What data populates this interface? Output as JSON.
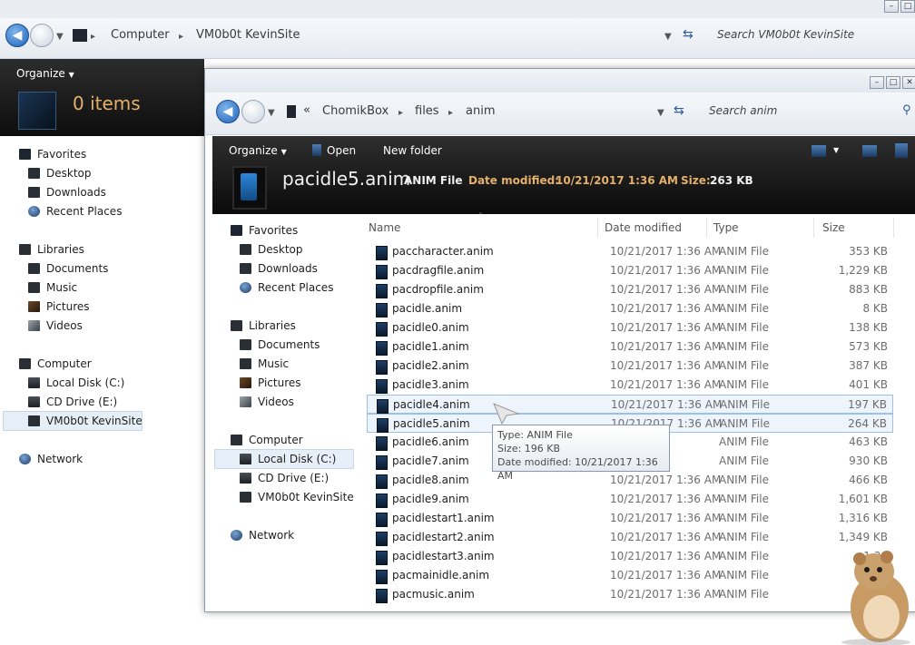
{
  "bg_window": {
    "breadcrumb": [
      "Computer",
      "VM0b0t KevinSite"
    ],
    "search_placeholder": "Search VM0b0t KevinSite",
    "organize_label": "Organize",
    "items_count": "0 items",
    "nav": {
      "favorites": {
        "label": "Favorites",
        "items": [
          "Desktop",
          "Downloads",
          "Recent Places"
        ]
      },
      "libraries": {
        "label": "Libraries",
        "items": [
          "Documents",
          "Music",
          "Pictures",
          "Videos"
        ]
      },
      "computer": {
        "label": "Computer",
        "items": [
          "Local Disk (C:)",
          "CD Drive (E:)",
          "VM0b0t KevinSite"
        ]
      },
      "network": "Network"
    }
  },
  "fg_window": {
    "breadcrumb_prefix": "«",
    "breadcrumb": [
      "ChomikBox",
      "files",
      "anim"
    ],
    "search_placeholder": "Search anim",
    "toolbar": {
      "organize": "Organize",
      "open": "Open",
      "new_folder": "New folder"
    },
    "details": {
      "filename": "pacidle5.anim",
      "type": "ANIM File",
      "date_label": "Date modified:",
      "date_value": "10/21/2017 1:36 AM",
      "size_label": "Size:",
      "size_value": "263 KB"
    },
    "nav": {
      "favorites": {
        "label": "Favorites",
        "items": [
          "Desktop",
          "Downloads",
          "Recent Places"
        ]
      },
      "libraries": {
        "label": "Libraries",
        "items": [
          "Documents",
          "Music",
          "Pictures",
          "Videos"
        ]
      },
      "computer": {
        "label": "Computer",
        "items": [
          "Local Disk (C:)",
          "CD Drive (E:)",
          "VM0b0t KevinSite"
        ]
      },
      "network": "Network"
    },
    "columns": {
      "name": "Name",
      "date": "Date modified",
      "type": "Type",
      "size": "Size"
    },
    "files": [
      {
        "name": "paccharacter.anim",
        "date": "10/21/2017 1:36 AM",
        "type": "ANIM File",
        "size": "353 KB"
      },
      {
        "name": "pacdragfile.anim",
        "date": "10/21/2017 1:36 AM",
        "type": "ANIM File",
        "size": "1,229 KB"
      },
      {
        "name": "pacdropfile.anim",
        "date": "10/21/2017 1:36 AM",
        "type": "ANIM File",
        "size": "883 KB"
      },
      {
        "name": "pacidle.anim",
        "date": "10/21/2017 1:36 AM",
        "type": "ANIM File",
        "size": "8 KB"
      },
      {
        "name": "pacidle0.anim",
        "date": "10/21/2017 1:36 AM",
        "type": "ANIM File",
        "size": "138 KB"
      },
      {
        "name": "pacidle1.anim",
        "date": "10/21/2017 1:36 AM",
        "type": "ANIM File",
        "size": "573 KB"
      },
      {
        "name": "pacidle2.anim",
        "date": "10/21/2017 1:36 AM",
        "type": "ANIM File",
        "size": "387 KB"
      },
      {
        "name": "pacidle3.anim",
        "date": "10/21/2017 1:36 AM",
        "type": "ANIM File",
        "size": "401 KB"
      },
      {
        "name": "pacidle4.anim",
        "date": "10/21/2017 1:36 AM",
        "type": "ANIM File",
        "size": "197 KB"
      },
      {
        "name": "pacidle5.anim",
        "date": "10/21/2017 1:36 AM",
        "type": "ANIM File",
        "size": "264 KB"
      },
      {
        "name": "pacidle6.anim",
        "date": "36 AM",
        "type": "ANIM File",
        "size": "463 KB"
      },
      {
        "name": "pacidle7.anim",
        "date": "36 AM",
        "type": "ANIM File",
        "size": "930 KB"
      },
      {
        "name": "pacidle8.anim",
        "date": "10/21/2017 1:36 AM",
        "type": "ANIM File",
        "size": "466 KB"
      },
      {
        "name": "pacidle9.anim",
        "date": "10/21/2017 1:36 AM",
        "type": "ANIM File",
        "size": "1,601 KB"
      },
      {
        "name": "pacidlestart1.anim",
        "date": "10/21/2017 1:36 AM",
        "type": "ANIM File",
        "size": "1,316 KB"
      },
      {
        "name": "pacidlestart2.anim",
        "date": "10/21/2017 1:36 AM",
        "type": "ANIM File",
        "size": "1,349 KB"
      },
      {
        "name": "pacidlestart3.anim",
        "date": "10/21/2017 1:36 AM",
        "type": "ANIM File",
        "size": "1,36"
      },
      {
        "name": "pacmainidle.anim",
        "date": "10/21/2017 1:36 AM",
        "type": "ANIM File",
        "size": ""
      },
      {
        "name": "pacmusic.anim",
        "date": "10/21/2017 1:36 AM",
        "type": "ANIM File",
        "size": "8"
      }
    ],
    "tooltip": {
      "type": "Type: ANIM File",
      "size": "Size: 196 KB",
      "date": "Date modified: 10/21/2017 1:36 AM"
    }
  },
  "colors": {
    "accent_orange": "#e4b06a",
    "selection_border": "#9cc1e6",
    "command_bar": "#1a1a1a"
  }
}
